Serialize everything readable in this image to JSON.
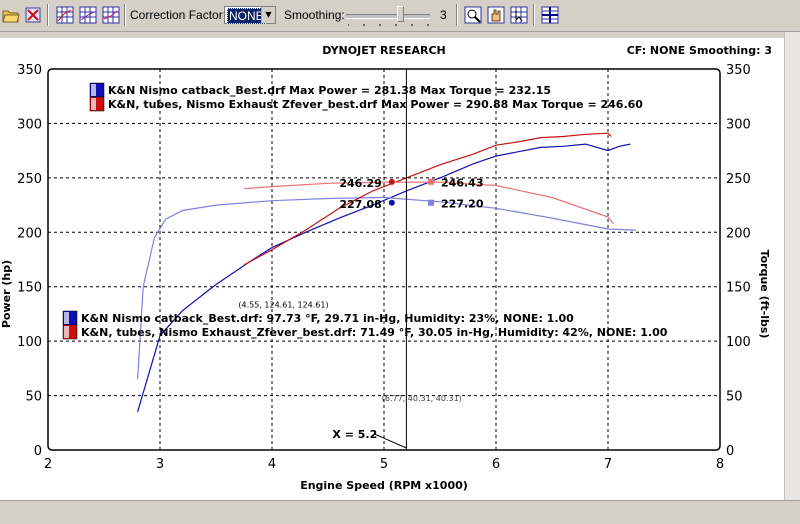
{
  "toolbar": {
    "correction_label": "Correction Factor:",
    "correction_value": "NONE",
    "smoothing_label": "Smoothing:",
    "smoothing_value": "3",
    "smoothing_level": 0.66,
    "icons": [
      "open-folder-icon",
      "clear-runs-icon",
      "grid-icon-1",
      "grid-icon-2",
      "grid-icon-3",
      "zoom-icon",
      "pan-icon",
      "cursor-icon",
      "crosshair-icon"
    ]
  },
  "header": {
    "title": "DYNOJET RESEARCH",
    "cf_text": "CF: NONE  Smoothing: 3"
  },
  "colors": {
    "blue": "#1010b0",
    "red": "#c81010",
    "light_blue": "#8080e0",
    "light_red": "#f07070"
  },
  "legend_top": [
    {
      "text": "K&N Nismo catback_Best.drf Max Power = 281.38 Max Torque = 232.15",
      "color": "blue"
    },
    {
      "text": "K&N, tubes, Nismo Exhaust  Zfever_best.drf Max Power = 290.88 Max Torque = 246.60",
      "color": "red"
    }
  ],
  "legend_bottom": [
    {
      "text": "K&N Nismo catback_Best.drf: 97.73 °F, 29.71 in-Hg, Humidity: 23%, NONE: 1.00",
      "color": "blue"
    },
    {
      "text": "K&N, tubes, Nismo Exhaust_Zfever_best.drf: 71.49 °F, 30.05 in-Hg, Humidity: 42%, NONE: 1.00",
      "color": "red"
    }
  ],
  "chart_data": {
    "type": "line",
    "title": "DYNOJET RESEARCH",
    "xlabel": "Engine Speed (RPM x1000)",
    "ylabel_left": "Power (hp)",
    "ylabel_right": "Torque (ft-lbs)",
    "xlim": [
      2,
      8
    ],
    "ylim": [
      0,
      350
    ],
    "xticks": [
      2,
      3,
      4,
      5,
      6,
      7,
      8
    ],
    "yticks": [
      0,
      50,
      100,
      150,
      200,
      250,
      300,
      350
    ],
    "grid": true,
    "cursor_x": 5.2,
    "cursor_label": "X = 5.2",
    "crosshair_labels": [
      "(4.55, 124.61, 124.61)",
      "(6.77, 40.31, 40.31)"
    ],
    "series": [
      {
        "name": "K&N Nismo catback_Best.drf Power",
        "color": "blue",
        "x": [
          2.8,
          3.0,
          3.2,
          3.5,
          3.8,
          4.0,
          4.3,
          4.6,
          4.9,
          5.2,
          5.5,
          5.8,
          6.0,
          6.2,
          6.4,
          6.6,
          6.8,
          7.0,
          7.1,
          7.2
        ],
        "y": [
          35,
          105,
          128,
          152,
          173,
          186,
          200,
          213,
          225,
          238,
          250,
          263,
          270,
          274,
          278,
          279,
          281,
          275,
          279,
          281
        ]
      },
      {
        "name": "K&N Nismo catback_Best.drf Torque",
        "color": "light_blue",
        "x": [
          2.8,
          2.85,
          2.95,
          3.05,
          3.2,
          3.5,
          4.0,
          4.5,
          5.0,
          5.5,
          6.0,
          6.5,
          7.0,
          7.25
        ],
        "y": [
          65,
          150,
          195,
          212,
          220,
          225,
          229,
          231,
          232,
          228,
          222,
          213,
          203,
          202
        ]
      },
      {
        "name": "K&N, tubes, Nismo Exhaust Zfever_best.drf Power",
        "color": "red",
        "x": [
          3.75,
          4.0,
          4.3,
          4.6,
          4.9,
          5.2,
          5.5,
          5.8,
          6.0,
          6.2,
          6.4,
          6.6,
          6.8,
          7.0,
          7.03
        ],
        "y": [
          170,
          184,
          202,
          222,
          238,
          250,
          262,
          272,
          280,
          283,
          287,
          288,
          290,
          291,
          288
        ]
      },
      {
        "name": "K&N, tubes, Nismo Exhaust Zfever_best.drf Torque",
        "color": "light_red",
        "x": [
          3.75,
          4.0,
          4.5,
          5.0,
          5.2,
          5.5,
          6.0,
          6.5,
          7.0,
          7.05
        ],
        "y": [
          240,
          242,
          245,
          246,
          246,
          246,
          243,
          232,
          214,
          208
        ]
      }
    ],
    "markers": [
      {
        "x": 5.07,
        "y": 246.29,
        "color": "red",
        "label": "246.29",
        "side": "left"
      },
      {
        "x": 5.42,
        "y": 246.43,
        "color": "light_red",
        "label": "246.43",
        "side": "right"
      },
      {
        "x": 5.07,
        "y": 227.08,
        "color": "blue",
        "label": "227.08",
        "side": "left"
      },
      {
        "x": 5.42,
        "y": 227.2,
        "color": "light_blue",
        "label": "227.20",
        "side": "right"
      }
    ]
  }
}
